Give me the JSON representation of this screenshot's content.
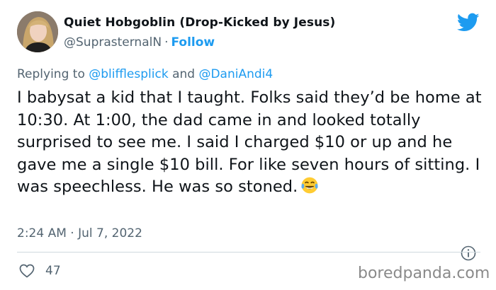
{
  "author": {
    "display_name": "Quiet Hobgoblin (Drop-Kicked by Jesus)",
    "handle": "@SuprasternalN",
    "separator": "·",
    "follow_label": "Follow",
    "avatar": "profile-photo"
  },
  "platform_icon": "twitter-bird-icon",
  "reply": {
    "prefix": "Replying to",
    "mention_1": "@blifflesplick",
    "conjunction": "and",
    "mention_2": "@DaniAndi4"
  },
  "tweet": {
    "text": "I babysat a kid that I taught. Folks said they’d be home at 10:30. At 1:00, the dad came in and looked totally surprised to see me. I said I charged $10 or up and he gave me a single $10 bill. For like seven hours of sitting. I was speechless. He was so stoned.",
    "emoji": "face-with-tears-of-joy-emoji"
  },
  "timestamp": "2:24 AM · Jul 7, 2022",
  "actions": {
    "like_icon": "heart-icon",
    "like_count": "47",
    "info_icon": "info-icon"
  },
  "watermark": "boredpanda.com",
  "colors": {
    "accent": "#1d9bf0",
    "text_primary": "#0f1419",
    "text_secondary": "#536471",
    "divider": "#cfd9de"
  }
}
